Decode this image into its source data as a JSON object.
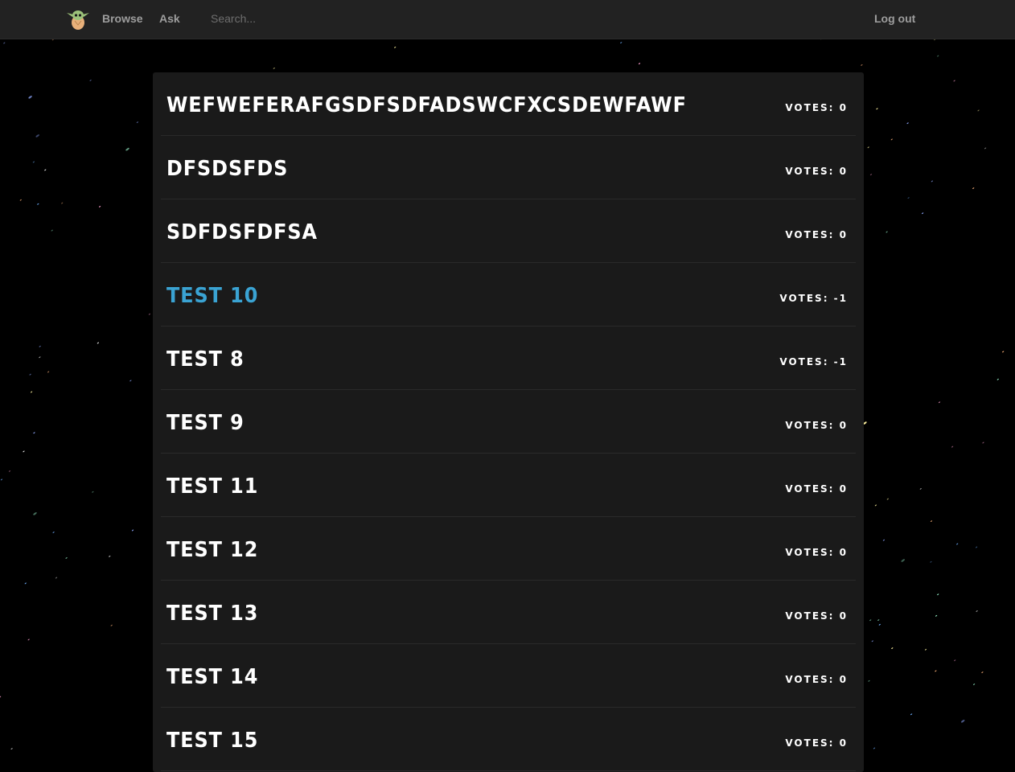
{
  "nav": {
    "browse_label": "Browse",
    "ask_label": "Ask",
    "search_placeholder": "Search...",
    "logout_label": "Log out",
    "logo_icon": "baby-yoda-logo-icon"
  },
  "questions": [
    {
      "title": "wefweferafgsdfsdfadswcfxcsdewfawf",
      "votes_text": "Votes: 0",
      "votes": 0,
      "highlighted": false
    },
    {
      "title": "dfsdsfds",
      "votes_text": "Votes: 0",
      "votes": 0,
      "highlighted": false
    },
    {
      "title": "sdfdsfdfsa",
      "votes_text": "Votes: 0",
      "votes": 0,
      "highlighted": false
    },
    {
      "title": "test 10",
      "votes_text": "Votes: -1",
      "votes": -1,
      "highlighted": true
    },
    {
      "title": "test 8",
      "votes_text": "Votes: -1",
      "votes": -1,
      "highlighted": false
    },
    {
      "title": "test 9",
      "votes_text": "Votes: 0",
      "votes": 0,
      "highlighted": false
    },
    {
      "title": "test 11",
      "votes_text": "Votes: 0",
      "votes": 0,
      "highlighted": false
    },
    {
      "title": "test 12",
      "votes_text": "Votes: 0",
      "votes": 0,
      "highlighted": false
    },
    {
      "title": "test 13",
      "votes_text": "Votes: 0",
      "votes": 0,
      "highlighted": false
    },
    {
      "title": "test 14",
      "votes_text": "Votes: 0",
      "votes": 0,
      "highlighted": false
    },
    {
      "title": "test 15",
      "votes_text": "Votes: 0",
      "votes": 0,
      "highlighted": false
    }
  ],
  "colors": {
    "navbar_bg": "#222222",
    "panel_bg": "#1a1a1a",
    "highlight": "#3aa3d3",
    "text": "#ffffff"
  }
}
